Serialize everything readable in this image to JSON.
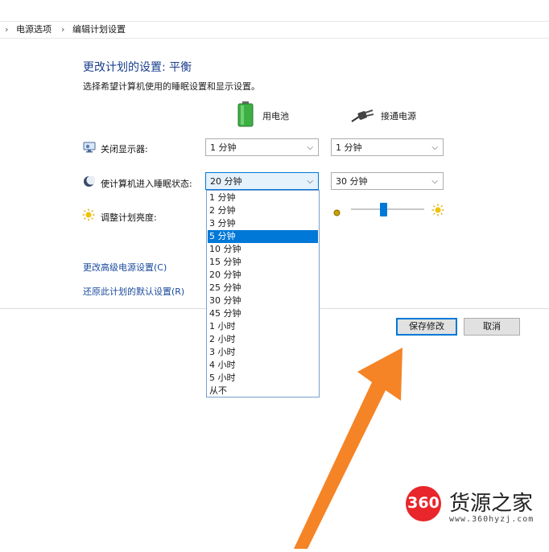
{
  "breadcrumb": {
    "sep": "›",
    "power_options": "电源选项",
    "edit_plan": "编辑计划设置"
  },
  "heading": {
    "title": "更改计划的设置: 平衡",
    "subtitle": "选择希望计算机使用的睡眠设置和显示设置。"
  },
  "columns": {
    "battery": "用电池",
    "plugged_in": "接通电源"
  },
  "rows": {
    "display_off": {
      "label": "关闭显示器:",
      "battery": "1 分钟",
      "plugged_in": "1 分钟"
    },
    "sleep": {
      "label": "使计算机进入睡眠状态:",
      "battery": "20 分钟",
      "plugged_in": "30 分钟"
    },
    "brightness": {
      "label": "调整计划亮度:",
      "plugged_in_level": 0.45
    }
  },
  "dropdown": {
    "options": [
      "1 分钟",
      "2 分钟",
      "3 分钟",
      "5 分钟",
      "10 分钟",
      "15 分钟",
      "20 分钟",
      "25 分钟",
      "30 分钟",
      "45 分钟",
      "1 小时",
      "2 小时",
      "3 小时",
      "4 小时",
      "5 小时",
      "从不"
    ],
    "highlighted": "5 分钟"
  },
  "links": {
    "advanced": "更改高级电源设置(C)",
    "restore": "还原此计划的默认设置(R)"
  },
  "buttons": {
    "save": "保存修改",
    "cancel": "取消"
  },
  "watermark": {
    "badge": "360",
    "text": "货源之家",
    "url": "www.360hyzj.com"
  },
  "colors": {
    "accent": "#0078d7",
    "arrow": "#f58426",
    "battery": "#3cb043",
    "badge": "#e8262b"
  }
}
